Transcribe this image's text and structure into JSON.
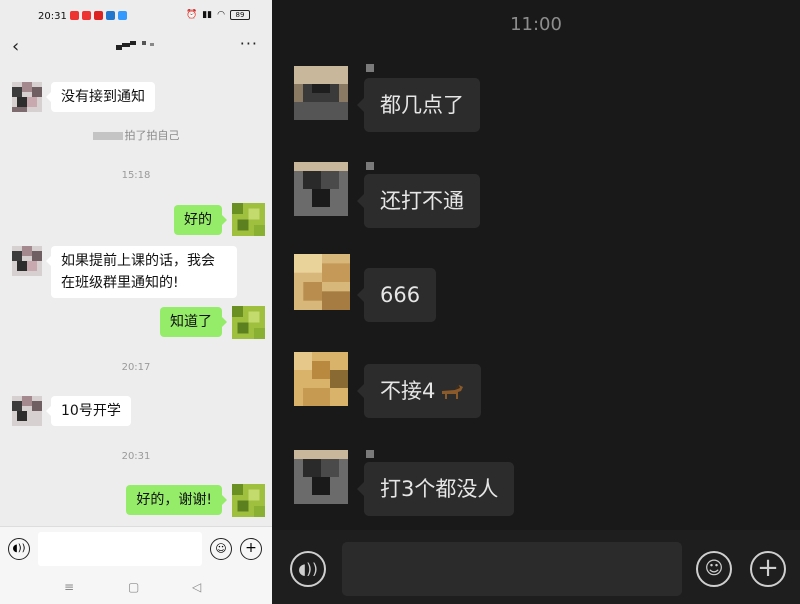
{
  "left": {
    "status_time": "20:31",
    "battery": "89",
    "timestamps": [
      "15:18",
      "20:17",
      "20:31"
    ],
    "system_message": "拍了拍自己",
    "messages": [
      {
        "side": "in",
        "text": "没有接到通知"
      },
      {
        "side": "out",
        "text": "好的"
      },
      {
        "side": "in",
        "text": "如果提前上课的话，我会在班级群里通知的!"
      },
      {
        "side": "out",
        "text": "知道了"
      },
      {
        "side": "in",
        "text": "10号开学"
      },
      {
        "side": "out",
        "text": "好的，谢谢!"
      }
    ]
  },
  "right": {
    "timestamp": "11:00",
    "messages": [
      {
        "text": "都几点了"
      },
      {
        "text": "还打不通"
      },
      {
        "text": "666"
      },
      {
        "text": "不接4"
      },
      {
        "text": "打3个都没人"
      }
    ]
  },
  "icons": {
    "voice": "voice-icon",
    "emoji": "emoji-icon",
    "plus": "plus-icon",
    "horse": "horse-emoji"
  }
}
